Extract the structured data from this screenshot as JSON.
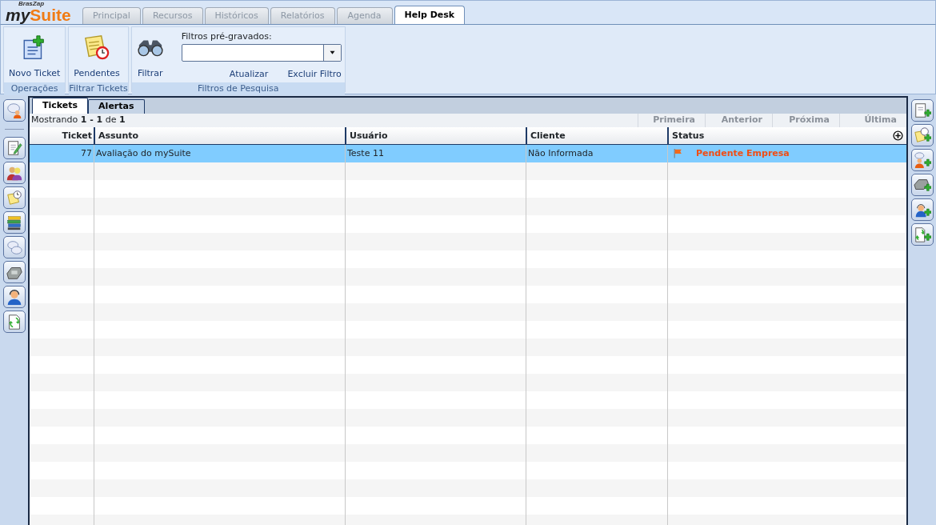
{
  "logo": {
    "small": "BrasZap",
    "name_a": "my",
    "name_b": "Suite"
  },
  "app_tabs": [
    {
      "label": "Principal",
      "selected": false
    },
    {
      "label": "Recursos",
      "selected": false
    },
    {
      "label": "Históricos",
      "selected": false
    },
    {
      "label": "Relatórios",
      "selected": false
    },
    {
      "label": "Agenda",
      "selected": false
    },
    {
      "label": "Help Desk",
      "selected": true
    }
  ],
  "ribbon": {
    "groups": [
      {
        "title": "Operações",
        "buttons": [
          {
            "label": "Novo Ticket"
          }
        ]
      },
      {
        "title": "Filtrar Tickets",
        "buttons": [
          {
            "label": "Pendentes"
          }
        ]
      },
      {
        "title": "Filtros de Pesquisa",
        "buttons": [
          {
            "label": "Filtrar"
          }
        ],
        "filter": {
          "label": "Filtros pré-gravados:",
          "links": [
            "Atualizar",
            "Excluir Filtro"
          ]
        }
      }
    ]
  },
  "view_tabs": [
    {
      "label": "Tickets",
      "selected": true
    },
    {
      "label": "Alertas",
      "selected": false
    }
  ],
  "paging": {
    "summary": "Mostrando **1 - 1** de **1**",
    "links": [
      {
        "label": "Primeira",
        "disabled": true
      },
      {
        "label": "Anterior",
        "disabled": true
      },
      {
        "label": "Próxima",
        "disabled": true
      },
      {
        "label": "Última",
        "disabled": true
      }
    ]
  },
  "table": {
    "columns": [
      "Ticket",
      "Assunto",
      "Usuário",
      "Cliente",
      "Status"
    ],
    "rows": [
      {
        "ticket": "77",
        "assunto": "Avaliação do mySuite",
        "usuario": "Teste 11",
        "cliente": "Não Informada",
        "status": "Pendente Empresa",
        "selected": true
      }
    ]
  }
}
